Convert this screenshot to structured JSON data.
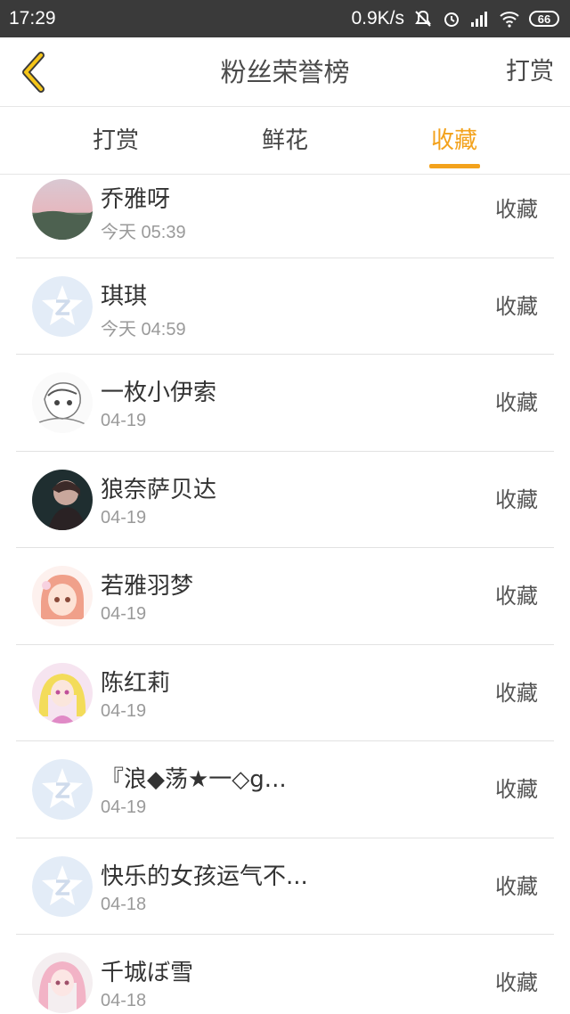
{
  "status_bar": {
    "time": "17:29",
    "net_speed": "0.9K/s",
    "battery": "66",
    "icons": [
      "mute-icon",
      "alarm-icon",
      "signal-icon",
      "wifi-icon",
      "battery-icon"
    ]
  },
  "header": {
    "title": "粉丝荣誉榜",
    "action": "打赏",
    "back_icon": "chevron-left-icon"
  },
  "tabs": [
    {
      "label": "打赏",
      "active": false
    },
    {
      "label": "鲜花",
      "active": false
    },
    {
      "label": "收藏",
      "active": true
    }
  ],
  "accent_color": "#f3a21c",
  "list": [
    {
      "name": "乔雅呀",
      "time": "今天 05:39",
      "action": "收藏",
      "avatar": "landscape"
    },
    {
      "name": "琪琪",
      "time": "今天 04:59",
      "action": "收藏",
      "avatar": "default-qq-icon"
    },
    {
      "name": "一枚小伊索",
      "time": "04-19",
      "action": "收藏",
      "avatar": "sketch"
    },
    {
      "name": "狼奈萨贝达",
      "time": "04-19",
      "action": "收藏",
      "avatar": "dark-portrait"
    },
    {
      "name": "若雅羽梦",
      "time": "04-19",
      "action": "收藏",
      "avatar": "anime-pink"
    },
    {
      "name": "陈红莉",
      "time": "04-19",
      "action": "收藏",
      "avatar": "anime-yellow"
    },
    {
      "name": "『浪◆荡★一◇g...",
      "time": "04-19",
      "action": "收藏",
      "avatar": "default-qq-icon"
    },
    {
      "name": "快乐的女孩运气不...",
      "time": "04-18",
      "action": "收藏",
      "avatar": "default-qq-icon"
    },
    {
      "name": "千城ぼ雪",
      "time": "04-18",
      "action": "收藏",
      "avatar": "anime-pink-hair"
    }
  ]
}
